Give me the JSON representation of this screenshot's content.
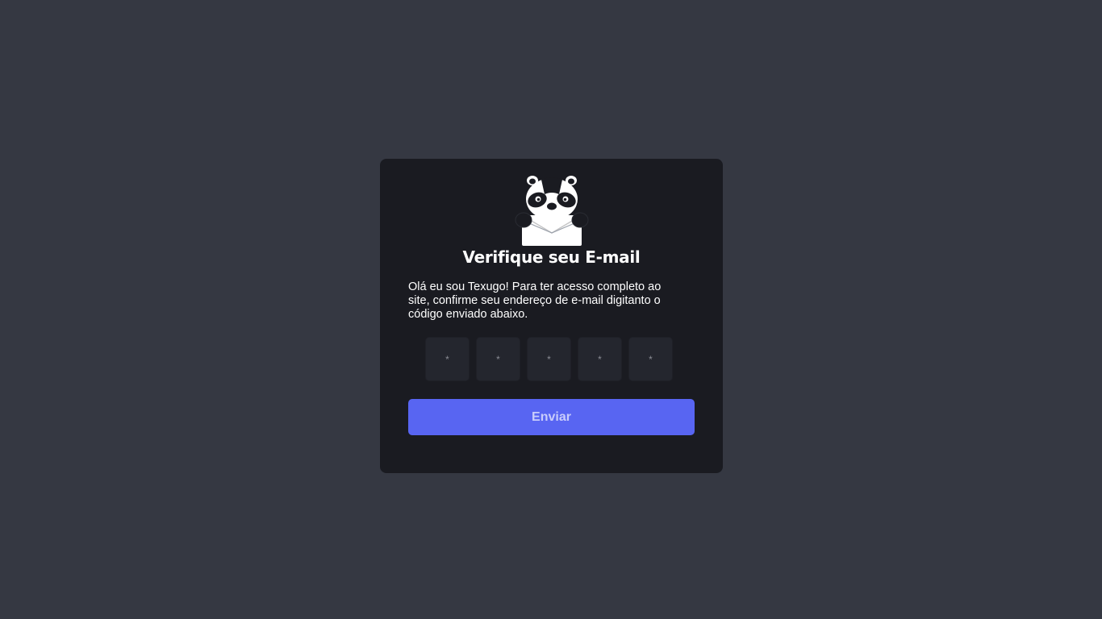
{
  "verification": {
    "title": "Verifique seu E-mail",
    "description": "Olá eu sou Texugo! Para ter acesso completo ao site, confirme seu endereço de e-mail digitanto o código enviado abaixo.",
    "code_inputs": [
      {
        "placeholder": "*",
        "value": ""
      },
      {
        "placeholder": "*",
        "value": ""
      },
      {
        "placeholder": "*",
        "value": ""
      },
      {
        "placeholder": "*",
        "value": ""
      },
      {
        "placeholder": "*",
        "value": ""
      }
    ],
    "submit_label": "Enviar",
    "mascot_icon": "badger-holding-envelope-icon"
  },
  "colors": {
    "page_background": "#353842",
    "card_background": "#1a1b21",
    "input_background": "#24262e",
    "accent": "#5865f2",
    "button_text": "#c8ccfb"
  }
}
